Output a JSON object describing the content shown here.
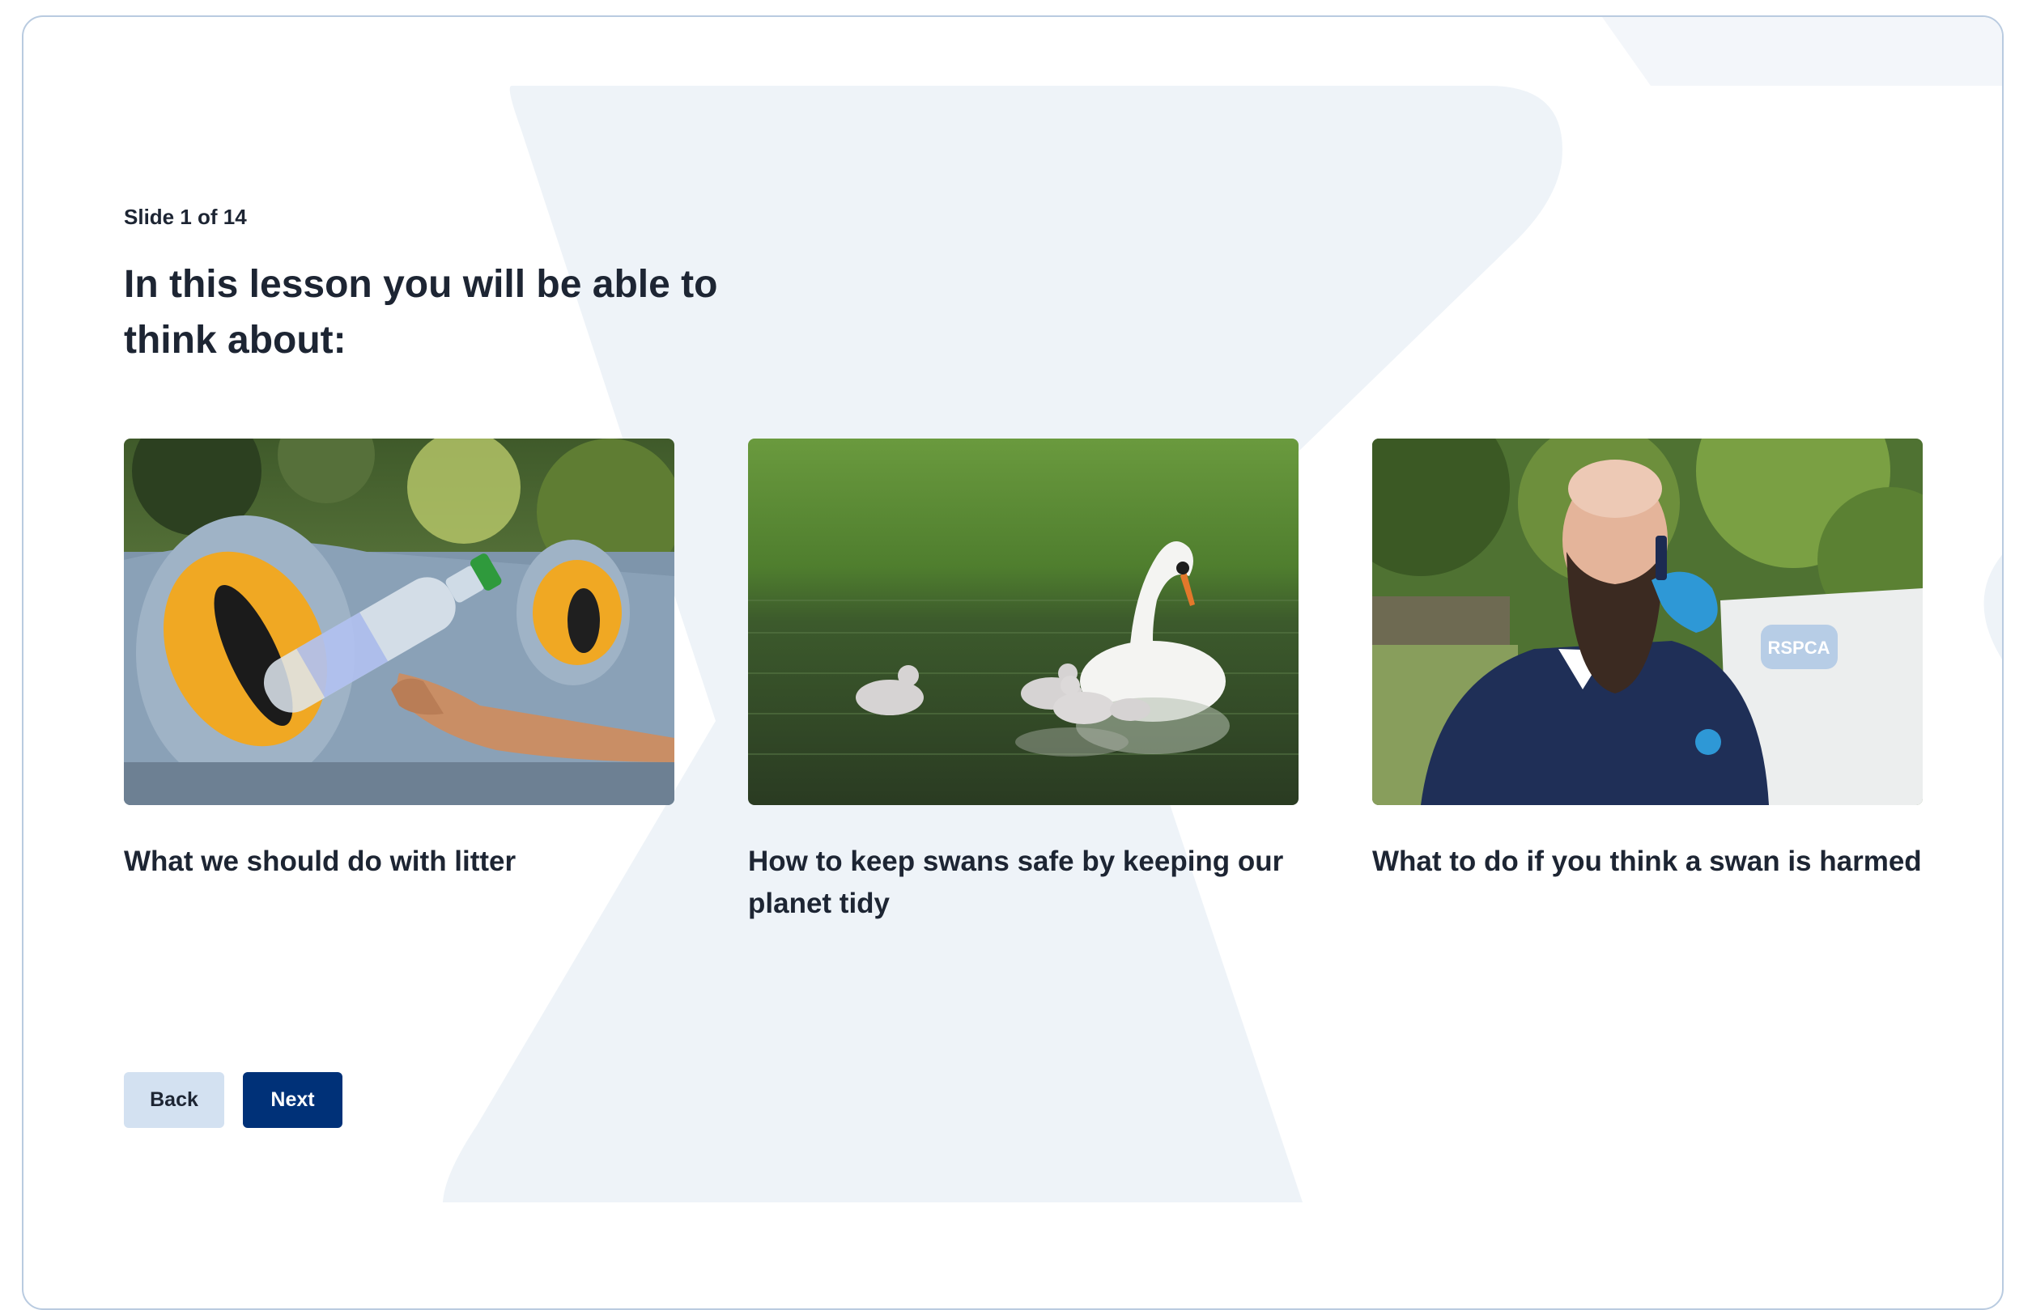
{
  "slide": {
    "counter": "Slide 1 of 14",
    "heading": "In this lesson you will be able to think about:"
  },
  "cards": [
    {
      "caption": "What we should do with litter",
      "image": "recycling-bottle-photo"
    },
    {
      "caption": "How to keep swans safe by keeping our planet tidy",
      "image": "swan-with-cygnets-photo"
    },
    {
      "caption": "What to do if you think a swan is harmed",
      "image": "rspca-officer-on-phone-photo",
      "van_logo": "RSPCA"
    }
  ],
  "navigation": {
    "back_label": "Back",
    "next_label": "Next"
  },
  "colors": {
    "primary": "#003178",
    "secondary": "#d3e1f1",
    "text": "#1d2533",
    "background_shape": "#eef3f8",
    "border": "#b9cbe0"
  }
}
